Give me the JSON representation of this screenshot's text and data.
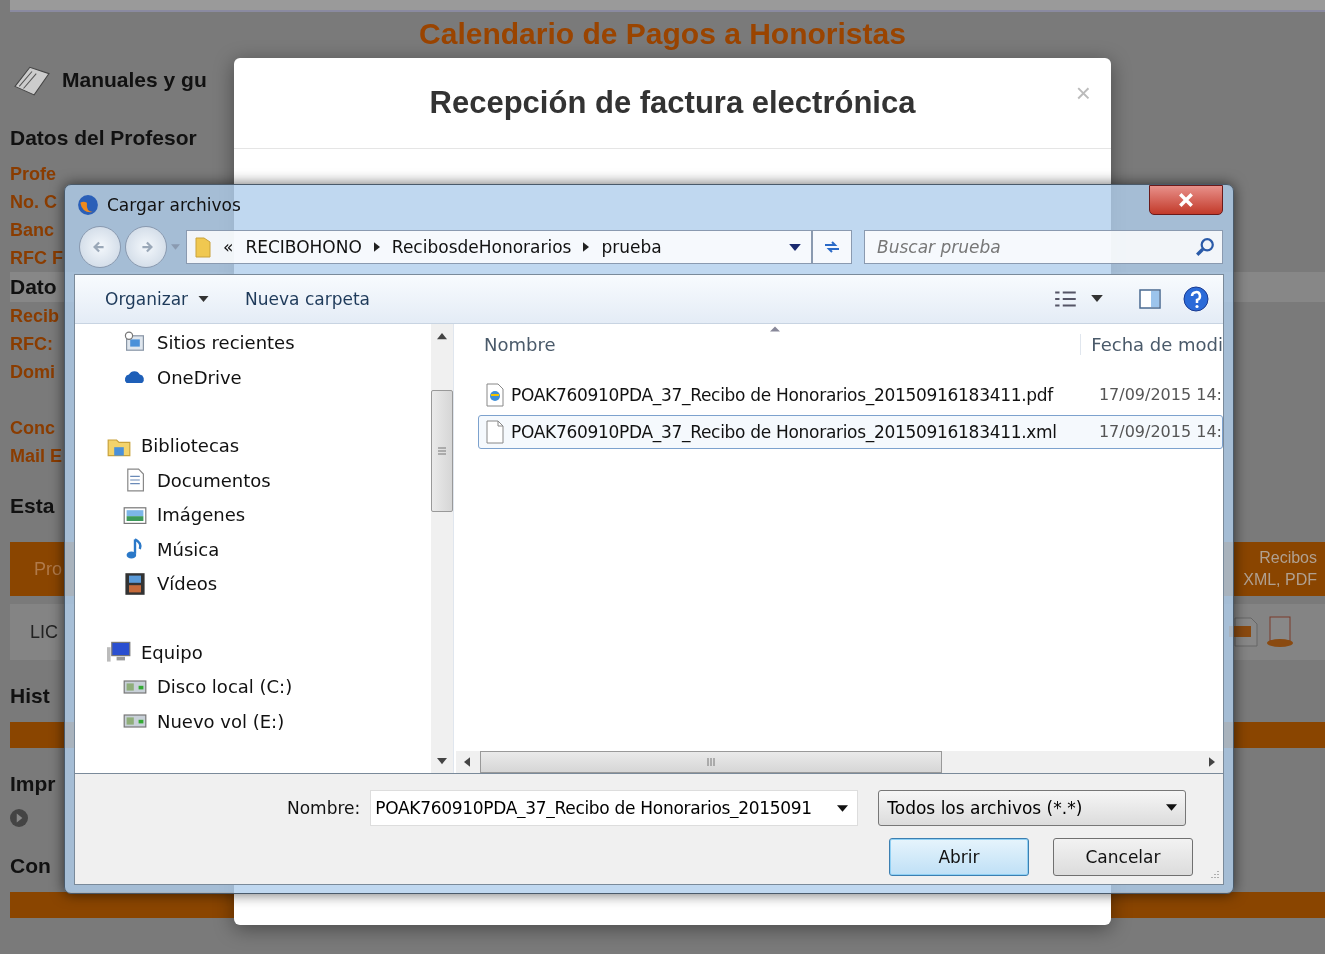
{
  "background_page": {
    "title": "Calendario de Pagos a Honoristas",
    "rows": [
      {
        "kind": "manual",
        "text": "Manuales y gu"
      },
      {
        "kind": "heading",
        "text": "Datos del Profesor"
      },
      {
        "kind": "field",
        "text": "Profe"
      },
      {
        "kind": "field",
        "text": "No. C"
      },
      {
        "kind": "field",
        "text": "Banc"
      },
      {
        "kind": "field",
        "text": "RFC F"
      },
      {
        "kind": "band",
        "text": "Dato"
      },
      {
        "kind": "field",
        "text": "Recib"
      },
      {
        "kind": "field",
        "text": "RFC:"
      },
      {
        "kind": "field",
        "text": "Domi"
      },
      {
        "kind": "gap"
      },
      {
        "kind": "field",
        "text": "Conc"
      },
      {
        "kind": "field",
        "text": "Mail E"
      },
      {
        "kind": "heading",
        "text": "Esta"
      },
      {
        "kind": "table-header",
        "text": "Pro",
        "right_lines": [
          "Recibos",
          "XML, PDF"
        ]
      },
      {
        "kind": "table-row",
        "text": "LIC"
      },
      {
        "kind": "heading",
        "text": "Hist"
      },
      {
        "kind": "strip"
      },
      {
        "kind": "heading",
        "text": "Impr"
      },
      {
        "kind": "bullet"
      },
      {
        "kind": "heading",
        "text": "Con"
      },
      {
        "kind": "strip"
      }
    ]
  },
  "modal": {
    "title": "Recepción de factura electrónica",
    "close": "×"
  },
  "dialog": {
    "title": "Cargar archivos",
    "breadcrumb": [
      "«",
      "RECIBOHONO",
      "RecibosdeHonorarios",
      "prueba"
    ],
    "search": {
      "placeholder": "Buscar prueba"
    },
    "toolbar": [
      {
        "kind": "menu",
        "label": "Organizar"
      },
      {
        "kind": "plain",
        "label": "Nueva carpeta"
      }
    ],
    "nav_tree": [
      {
        "children": [
          {
            "kind": "recent",
            "label": "Sitios recientes"
          },
          {
            "kind": "cloud",
            "label": "OneDrive"
          }
        ]
      },
      {
        "kind": "library",
        "label": "Bibliotecas",
        "children": [
          {
            "kind": "document",
            "label": "Documentos"
          },
          {
            "kind": "image",
            "label": "Imágenes"
          },
          {
            "kind": "music",
            "label": "Música"
          },
          {
            "kind": "video",
            "label": "Vídeos"
          }
        ]
      },
      {
        "kind": "computer",
        "label": "Equipo",
        "children": [
          {
            "kind": "drive",
            "label": "Disco local (C:)"
          },
          {
            "kind": "drive",
            "label": "Nuevo vol (E:)"
          }
        ]
      }
    ],
    "columns": [
      "Nombre",
      "Fecha de modi"
    ],
    "files": [
      {
        "kind": "pdf",
        "name": "POAK760910PDA_37_Recibo de Honorarios_20150916183411.pdf",
        "date": "17/09/2015 14:",
        "selected": false
      },
      {
        "kind": "file",
        "name": "POAK760910PDA_37_Recibo de Honorarios_20150916183411.xml",
        "date": "17/09/2015 14:",
        "selected": true
      }
    ],
    "filename_label": "Nombre:",
    "filename_value": "POAK760910PDA_37_Recibo de Honorarios_2015091",
    "filetype": "Todos los archivos (*.*)",
    "buttons": [
      {
        "label": "Abrir",
        "default": true
      },
      {
        "label": "Cancelar",
        "default": false
      }
    ]
  }
}
